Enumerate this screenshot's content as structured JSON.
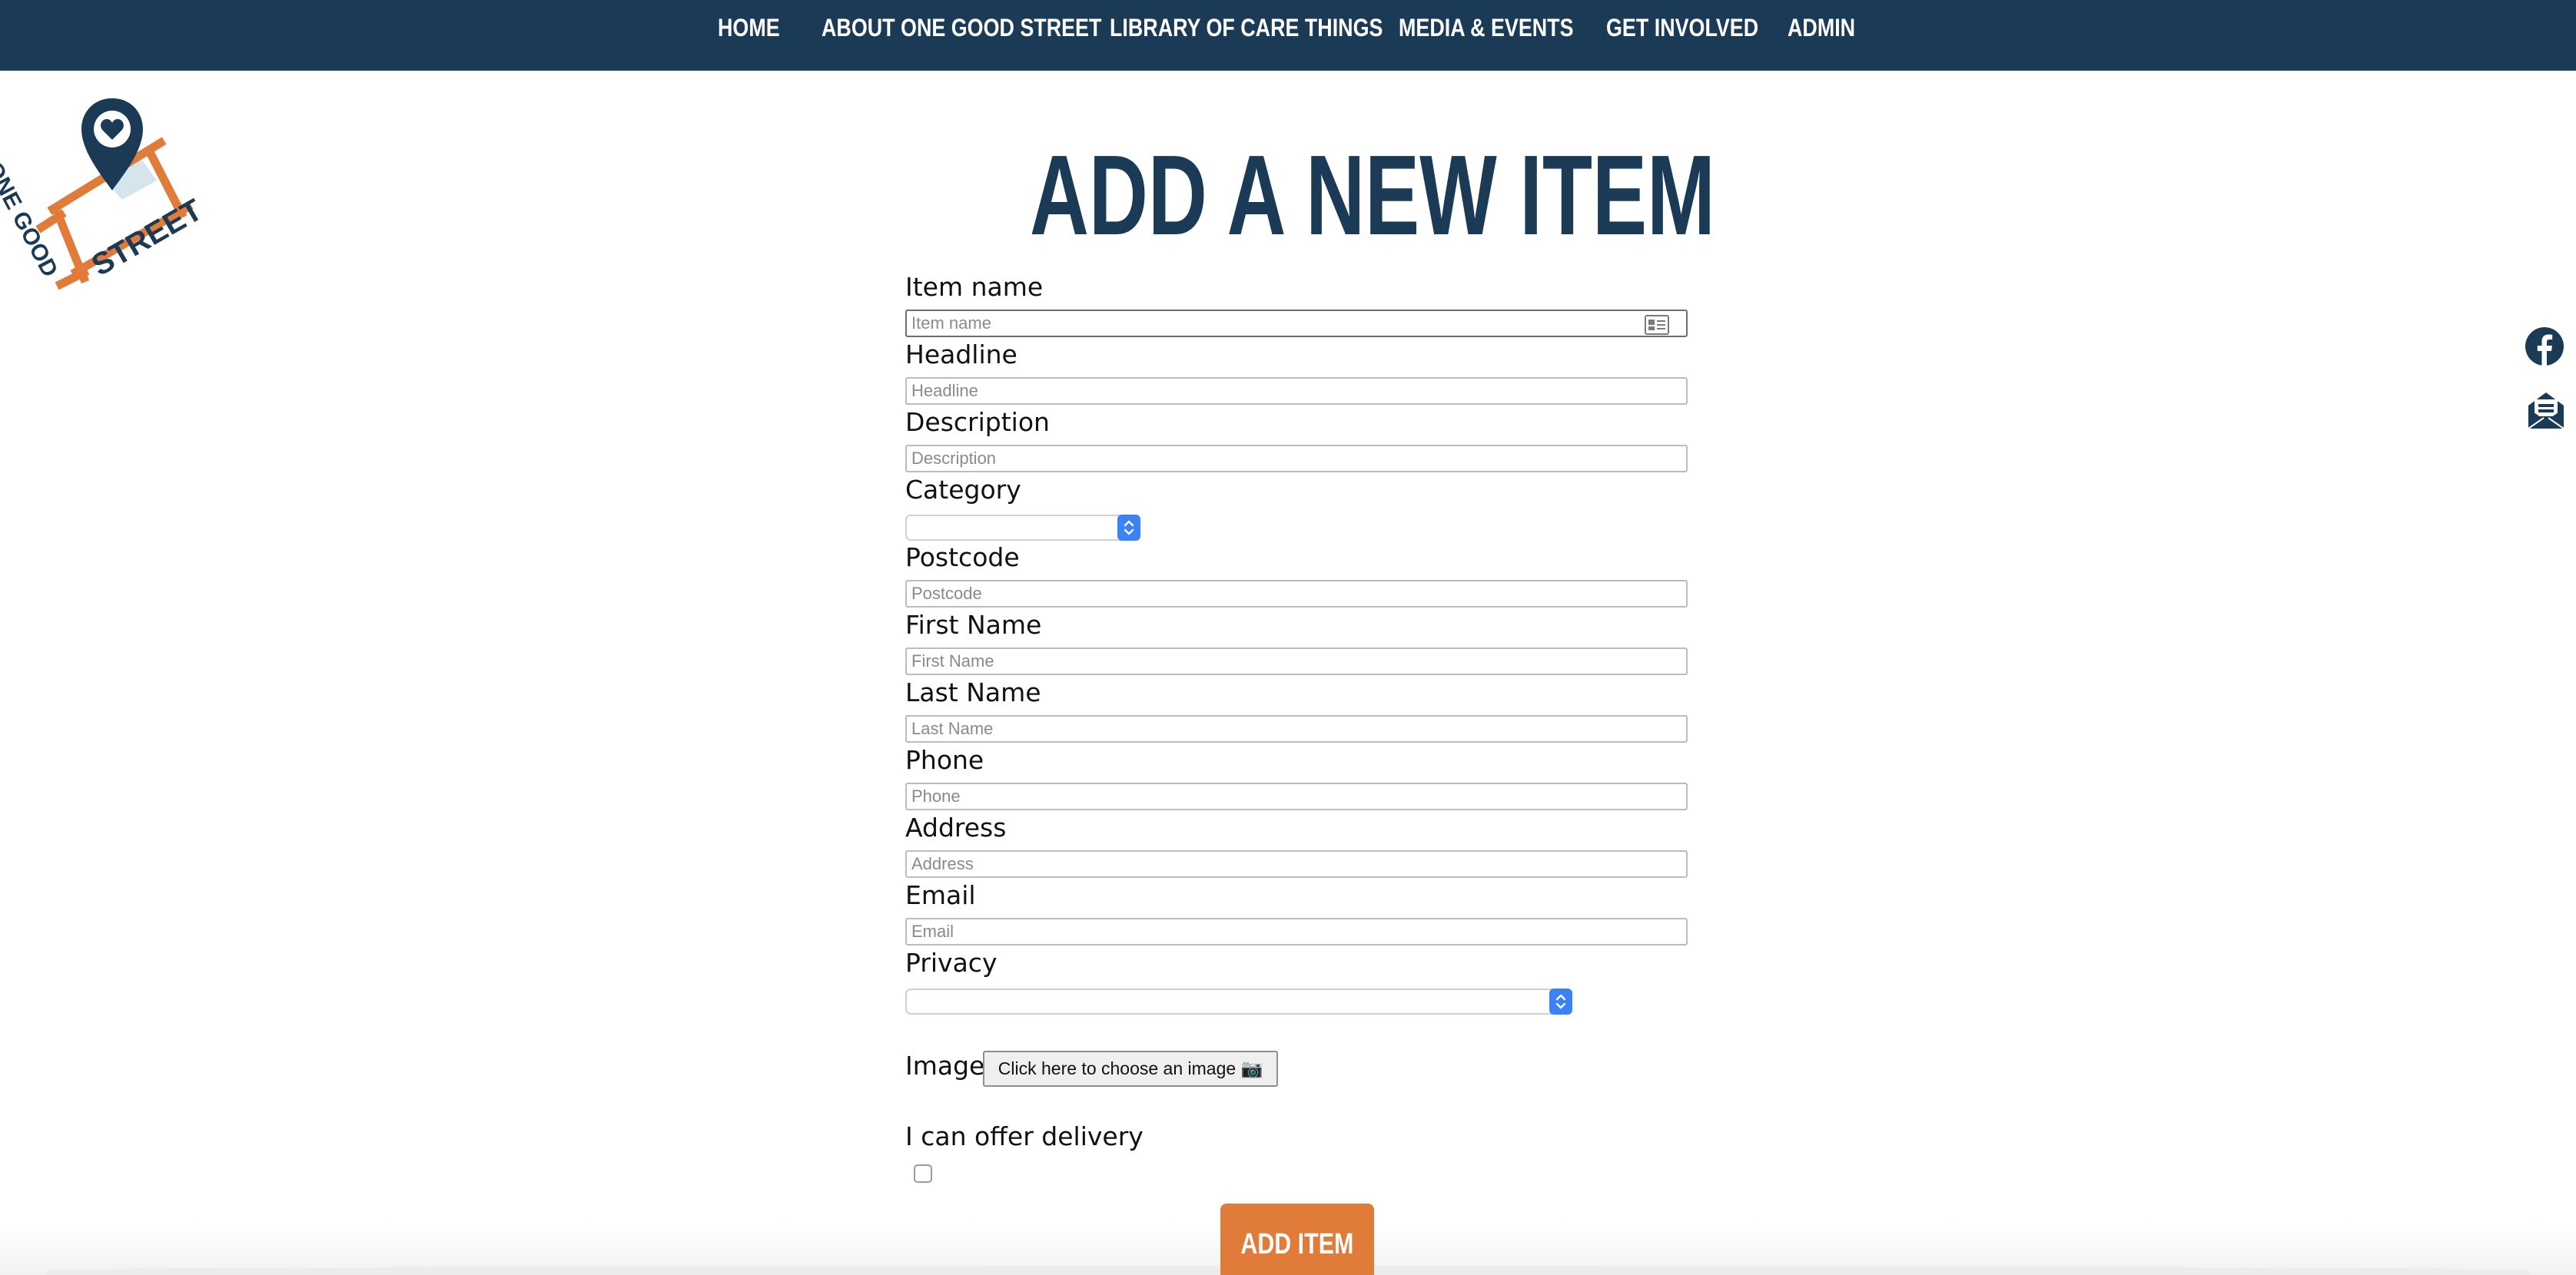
{
  "nav": {
    "items": [
      {
        "label": "HOME"
      },
      {
        "label": "ABOUT ONE GOOD STREET"
      },
      {
        "label": "LIBRARY OF CARE THINGS"
      },
      {
        "label": "MEDIA & EVENTS"
      },
      {
        "label": "GET INVOLVED"
      },
      {
        "label": "ADMIN"
      }
    ]
  },
  "logo": {
    "line1": "ONE GOOD",
    "line2": "STREET"
  },
  "colors": {
    "navy": "#1b3a55",
    "orange": "#e07b39",
    "select_blue": "#3b82f6"
  },
  "page": {
    "title": "ADD A NEW ITEM"
  },
  "form": {
    "item_name": {
      "label": "Item name",
      "placeholder": "Item name"
    },
    "headline": {
      "label": "Headline",
      "placeholder": "Headline"
    },
    "description": {
      "label": "Description",
      "placeholder": "Description"
    },
    "category": {
      "label": "Category",
      "value": ""
    },
    "postcode": {
      "label": "Postcode",
      "placeholder": "Postcode"
    },
    "first_name": {
      "label": "First Name",
      "placeholder": "First Name"
    },
    "last_name": {
      "label": "Last Name",
      "placeholder": "Last Name"
    },
    "phone": {
      "label": "Phone",
      "placeholder": "Phone"
    },
    "address": {
      "label": "Address",
      "placeholder": "Address"
    },
    "email": {
      "label": "Email",
      "placeholder": "Email"
    },
    "privacy": {
      "label": "Privacy",
      "value": ""
    },
    "image": {
      "label": "Image",
      "button": "Click here to choose an image 📷"
    },
    "delivery": {
      "label": "I can offer delivery",
      "checked": false
    },
    "submit": "ADD ITEM"
  },
  "icons": {
    "autofill": "contact-card-icon",
    "social": [
      "facebook-icon",
      "mail-icon"
    ]
  }
}
